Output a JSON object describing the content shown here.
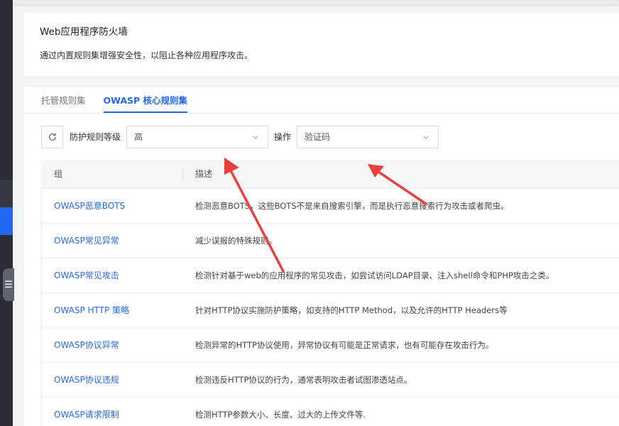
{
  "header": {
    "title": "Web应用程序防火墙",
    "description": "通过内置规则集增强安全性，以阻止各种应用程序攻击。"
  },
  "tabs": [
    {
      "label": "托管规则集",
      "active": false
    },
    {
      "label": "OWASP 核心规则集",
      "active": true
    }
  ],
  "toolbar": {
    "refresh_icon": "refresh-icon",
    "level_label": "防护规则等级",
    "level_value": "高",
    "action_label": "操作",
    "action_value": "验证码"
  },
  "table": {
    "columns": [
      "组",
      "描述"
    ],
    "rows": [
      {
        "group": "OWASP恶意BOTS",
        "desc": "检测恶意BOTS，这些BOTS不是来自搜索引擎，而是执行恶意搜索行为攻击或者爬虫。"
      },
      {
        "group": "OWASP常见异常",
        "desc": "减少误报的特殊规则。"
      },
      {
        "group": "OWASP常见攻击",
        "desc": "检测针对基于web的应用程序的常见攻击，如尝试访问LDAP目录、注入shell命令和PHP攻击之类。"
      },
      {
        "group": "OWASP HTTP 策略",
        "desc": "针对HTTP协议实施防护策略，如支持的HTTP Method，以及允许的HTTP Headers等"
      },
      {
        "group": "OWASP协议异常",
        "desc": "检测异常的HTTP协议使用，异常协议有可能是正常请求，也有可能存在攻击行为。"
      },
      {
        "group": "OWASP协议违规",
        "desc": "检测违反HTTP协议的行为，通常表明攻击者试图渗透站点。"
      },
      {
        "group": "OWASP请求限制",
        "desc": "检测HTTP参数大小、长度、过大的上传文件等."
      }
    ]
  },
  "colors": {
    "accent": "#2468f2",
    "annotation": "#e8403c",
    "sidebar": "#2a2d35"
  }
}
